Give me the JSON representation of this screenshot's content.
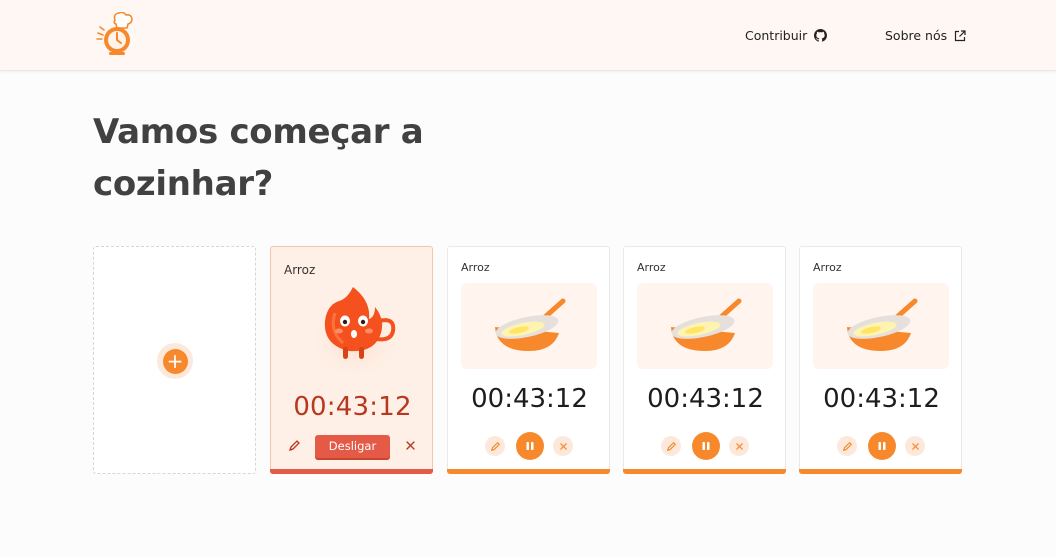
{
  "header": {
    "logo": "stopwatch-chef-logo",
    "nav": {
      "contribute_label": "Contribuir",
      "contribute_icon": "github-icon",
      "about_label": "Sobre nós",
      "about_icon": "external-link-icon"
    }
  },
  "main": {
    "title": "Vamos começar a cozinhar?",
    "add_card": {
      "icon": "plus-icon"
    },
    "alarm_card": {
      "label": "Arroz",
      "image": "fire-mascot",
      "time": "00:43:12",
      "off_button": "Desligar",
      "state_color": "#e55a46"
    },
    "timers": [
      {
        "label": "Arroz",
        "image": "frying-pan",
        "time": "00:43:12"
      },
      {
        "label": "Arroz",
        "image": "frying-pan",
        "time": "00:43:12"
      },
      {
        "label": "Arroz",
        "image": "frying-pan",
        "time": "00:43:12"
      }
    ]
  },
  "colors": {
    "accent": "#f7892c",
    "alarm": "#e55a46",
    "alarm_time": "#b8371f",
    "header_bg": "#fff7f3"
  }
}
